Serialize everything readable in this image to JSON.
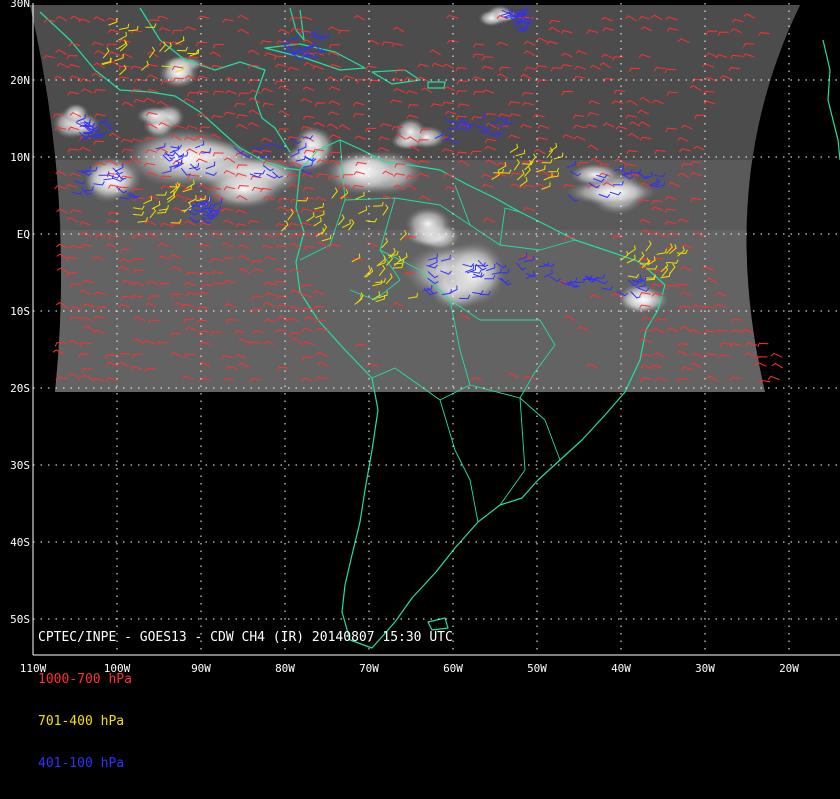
{
  "map": {
    "title": "CPTEC/INPE - GOES13 - CDW CH4 (IR) 20140807 15:30 UTC",
    "lat_labels": [
      "30N",
      "20N",
      "10N",
      "EQ",
      "10S",
      "20S",
      "30S",
      "40S",
      "50S"
    ],
    "lat_values": [
      30,
      20,
      10,
      0,
      -10,
      -20,
      -30,
      -40,
      -50
    ],
    "lon_labels": [
      "110W",
      "100W",
      "90W",
      "80W",
      "70W",
      "60W",
      "50W",
      "40W",
      "30W",
      "20W"
    ],
    "lon_values": [
      -110,
      -100,
      -90,
      -80,
      -70,
      -60,
      -50,
      -40,
      -30,
      -20
    ],
    "legend": [
      {
        "label": "1000-700 hPa",
        "color": "#ff3030"
      },
      {
        "label": "701-400 hPa",
        "color": "#f0e000"
      },
      {
        "label": "401-100 hPa",
        "color": "#3030ff"
      }
    ],
    "colors": {
      "coastline": "#20e0a0",
      "grid": "#ffffff",
      "background": "#000000",
      "title": "#ffffff"
    }
  }
}
